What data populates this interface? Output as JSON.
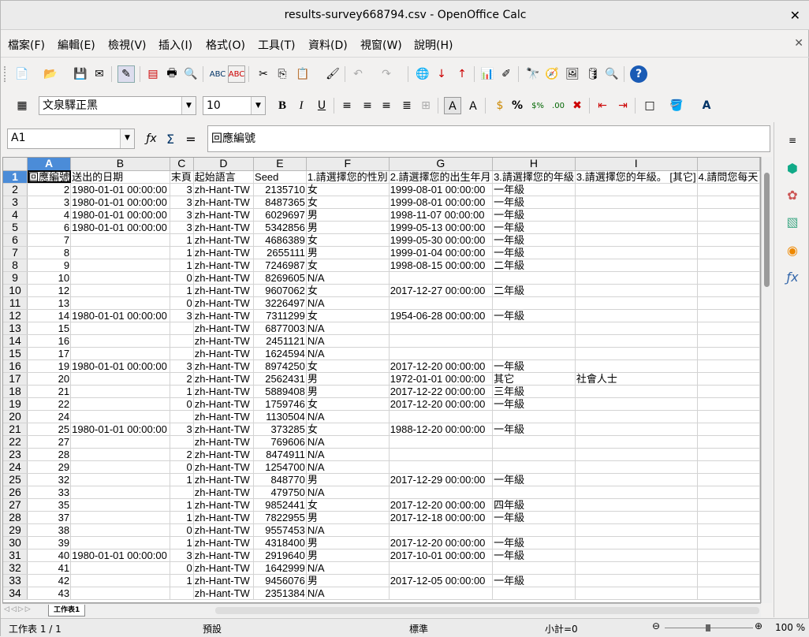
{
  "window": {
    "title": "results-survey668794.csv - OpenOffice Calc"
  },
  "menu": [
    "檔案(F)",
    "編輯(E)",
    "檢視(V)",
    "插入(I)",
    "格式(O)",
    "工具(T)",
    "資料(D)",
    "視窗(W)",
    "說明(H)"
  ],
  "format_bar": {
    "font_name": "文泉驛正黑",
    "font_size": "10"
  },
  "formula_bar": {
    "name_box": "A1",
    "content": "回應編號",
    "equals": "="
  },
  "columns": [
    "A",
    "B",
    "C",
    "D",
    "E",
    "F",
    "G",
    "H",
    "I",
    ""
  ],
  "header_row": [
    "回應編號",
    "送出的日期",
    "末頁",
    "起始語言",
    "Seed",
    "1.請選擇您的性別",
    "2.請選擇您的出生年月",
    "3.請選擇您的年級",
    "3.請選擇您的年級。 [其它]",
    "4.請問您每天"
  ],
  "rows": [
    [
      "2",
      "1980-01-01 00:00:00",
      "3",
      "zh-Hant-TW",
      "2135710",
      "女",
      "1999-08-01 00:00:00",
      "一年級",
      ""
    ],
    [
      "3",
      "1980-01-01 00:00:00",
      "3",
      "zh-Hant-TW",
      "8487365",
      "女",
      "1999-08-01 00:00:00",
      "一年級",
      ""
    ],
    [
      "4",
      "1980-01-01 00:00:00",
      "3",
      "zh-Hant-TW",
      "6029697",
      "男",
      "1998-11-07 00:00:00",
      "一年級",
      ""
    ],
    [
      "6",
      "1980-01-01 00:00:00",
      "3",
      "zh-Hant-TW",
      "5342856",
      "男",
      "1999-05-13 00:00:00",
      "一年級",
      ""
    ],
    [
      "7",
      "",
      "1",
      "zh-Hant-TW",
      "4686389",
      "女",
      "1999-05-30 00:00:00",
      "一年級",
      ""
    ],
    [
      "8",
      "",
      "1",
      "zh-Hant-TW",
      "2655111",
      "男",
      "1999-01-04 00:00:00",
      "一年級",
      ""
    ],
    [
      "9",
      "",
      "1",
      "zh-Hant-TW",
      "7246987",
      "女",
      "1998-08-15 00:00:00",
      "二年級",
      ""
    ],
    [
      "10",
      "",
      "0",
      "zh-Hant-TW",
      "8269605",
      "N/A",
      "",
      "",
      ""
    ],
    [
      "12",
      "",
      "1",
      "zh-Hant-TW",
      "9607062",
      "女",
      "2017-12-27 00:00:00",
      "二年級",
      ""
    ],
    [
      "13",
      "",
      "0",
      "zh-Hant-TW",
      "3226497",
      "N/A",
      "",
      "",
      ""
    ],
    [
      "14",
      "1980-01-01 00:00:00",
      "3",
      "zh-Hant-TW",
      "7311299",
      "女",
      "1954-06-28 00:00:00",
      "一年級",
      ""
    ],
    [
      "15",
      "",
      "",
      "zh-Hant-TW",
      "6877003",
      "N/A",
      "",
      "",
      ""
    ],
    [
      "16",
      "",
      "",
      "zh-Hant-TW",
      "2451121",
      "N/A",
      "",
      "",
      ""
    ],
    [
      "17",
      "",
      "",
      "zh-Hant-TW",
      "1624594",
      "N/A",
      "",
      "",
      ""
    ],
    [
      "19",
      "1980-01-01 00:00:00",
      "3",
      "zh-Hant-TW",
      "8974250",
      "女",
      "2017-12-20 00:00:00",
      "一年級",
      ""
    ],
    [
      "20",
      "",
      "2",
      "zh-Hant-TW",
      "2562431",
      "男",
      "1972-01-01 00:00:00",
      "其它",
      "社會人士"
    ],
    [
      "21",
      "",
      "1",
      "zh-Hant-TW",
      "5889408",
      "男",
      "2017-12-22 00:00:00",
      "三年級",
      ""
    ],
    [
      "22",
      "",
      "0",
      "zh-Hant-TW",
      "1759746",
      "女",
      "2017-12-20 00:00:00",
      "一年級",
      ""
    ],
    [
      "24",
      "",
      "",
      "zh-Hant-TW",
      "1130504",
      "N/A",
      "",
      "",
      ""
    ],
    [
      "25",
      "1980-01-01 00:00:00",
      "3",
      "zh-Hant-TW",
      "373285",
      "女",
      "1988-12-20 00:00:00",
      "一年級",
      ""
    ],
    [
      "27",
      "",
      "",
      "zh-Hant-TW",
      "769606",
      "N/A",
      "",
      "",
      ""
    ],
    [
      "28",
      "",
      "2",
      "zh-Hant-TW",
      "8474911",
      "N/A",
      "",
      "",
      ""
    ],
    [
      "29",
      "",
      "0",
      "zh-Hant-TW",
      "1254700",
      "N/A",
      "",
      "",
      ""
    ],
    [
      "32",
      "",
      "1",
      "zh-Hant-TW",
      "848770",
      "男",
      "2017-12-29 00:00:00",
      "一年級",
      ""
    ],
    [
      "33",
      "",
      "",
      "zh-Hant-TW",
      "479750",
      "N/A",
      "",
      "",
      ""
    ],
    [
      "35",
      "",
      "1",
      "zh-Hant-TW",
      "9852441",
      "女",
      "2017-12-20 00:00:00",
      "四年級",
      ""
    ],
    [
      "37",
      "",
      "1",
      "zh-Hant-TW",
      "7822955",
      "男",
      "2017-12-18 00:00:00",
      "一年級",
      ""
    ],
    [
      "38",
      "",
      "0",
      "zh-Hant-TW",
      "9557453",
      "N/A",
      "",
      "",
      ""
    ],
    [
      "39",
      "",
      "1",
      "zh-Hant-TW",
      "4318400",
      "男",
      "2017-12-20 00:00:00",
      "一年級",
      ""
    ],
    [
      "40",
      "1980-01-01 00:00:00",
      "3",
      "zh-Hant-TW",
      "2919640",
      "男",
      "2017-10-01 00:00:00",
      "一年級",
      ""
    ],
    [
      "41",
      "",
      "0",
      "zh-Hant-TW",
      "1642999",
      "N/A",
      "",
      "",
      ""
    ],
    [
      "42",
      "",
      "1",
      "zh-Hant-TW",
      "9456076",
      "男",
      "2017-12-05 00:00:00",
      "一年級",
      ""
    ],
    [
      "43",
      "",
      "",
      "zh-Hant-TW",
      "2351384",
      "N/A",
      "",
      "",
      ""
    ]
  ],
  "sheet_tab": "工作表1",
  "status": {
    "sheet": "工作表 1 / 1",
    "style": "預設",
    "mode": "標準",
    "sum": "小計=0",
    "zoom": "100 %"
  }
}
